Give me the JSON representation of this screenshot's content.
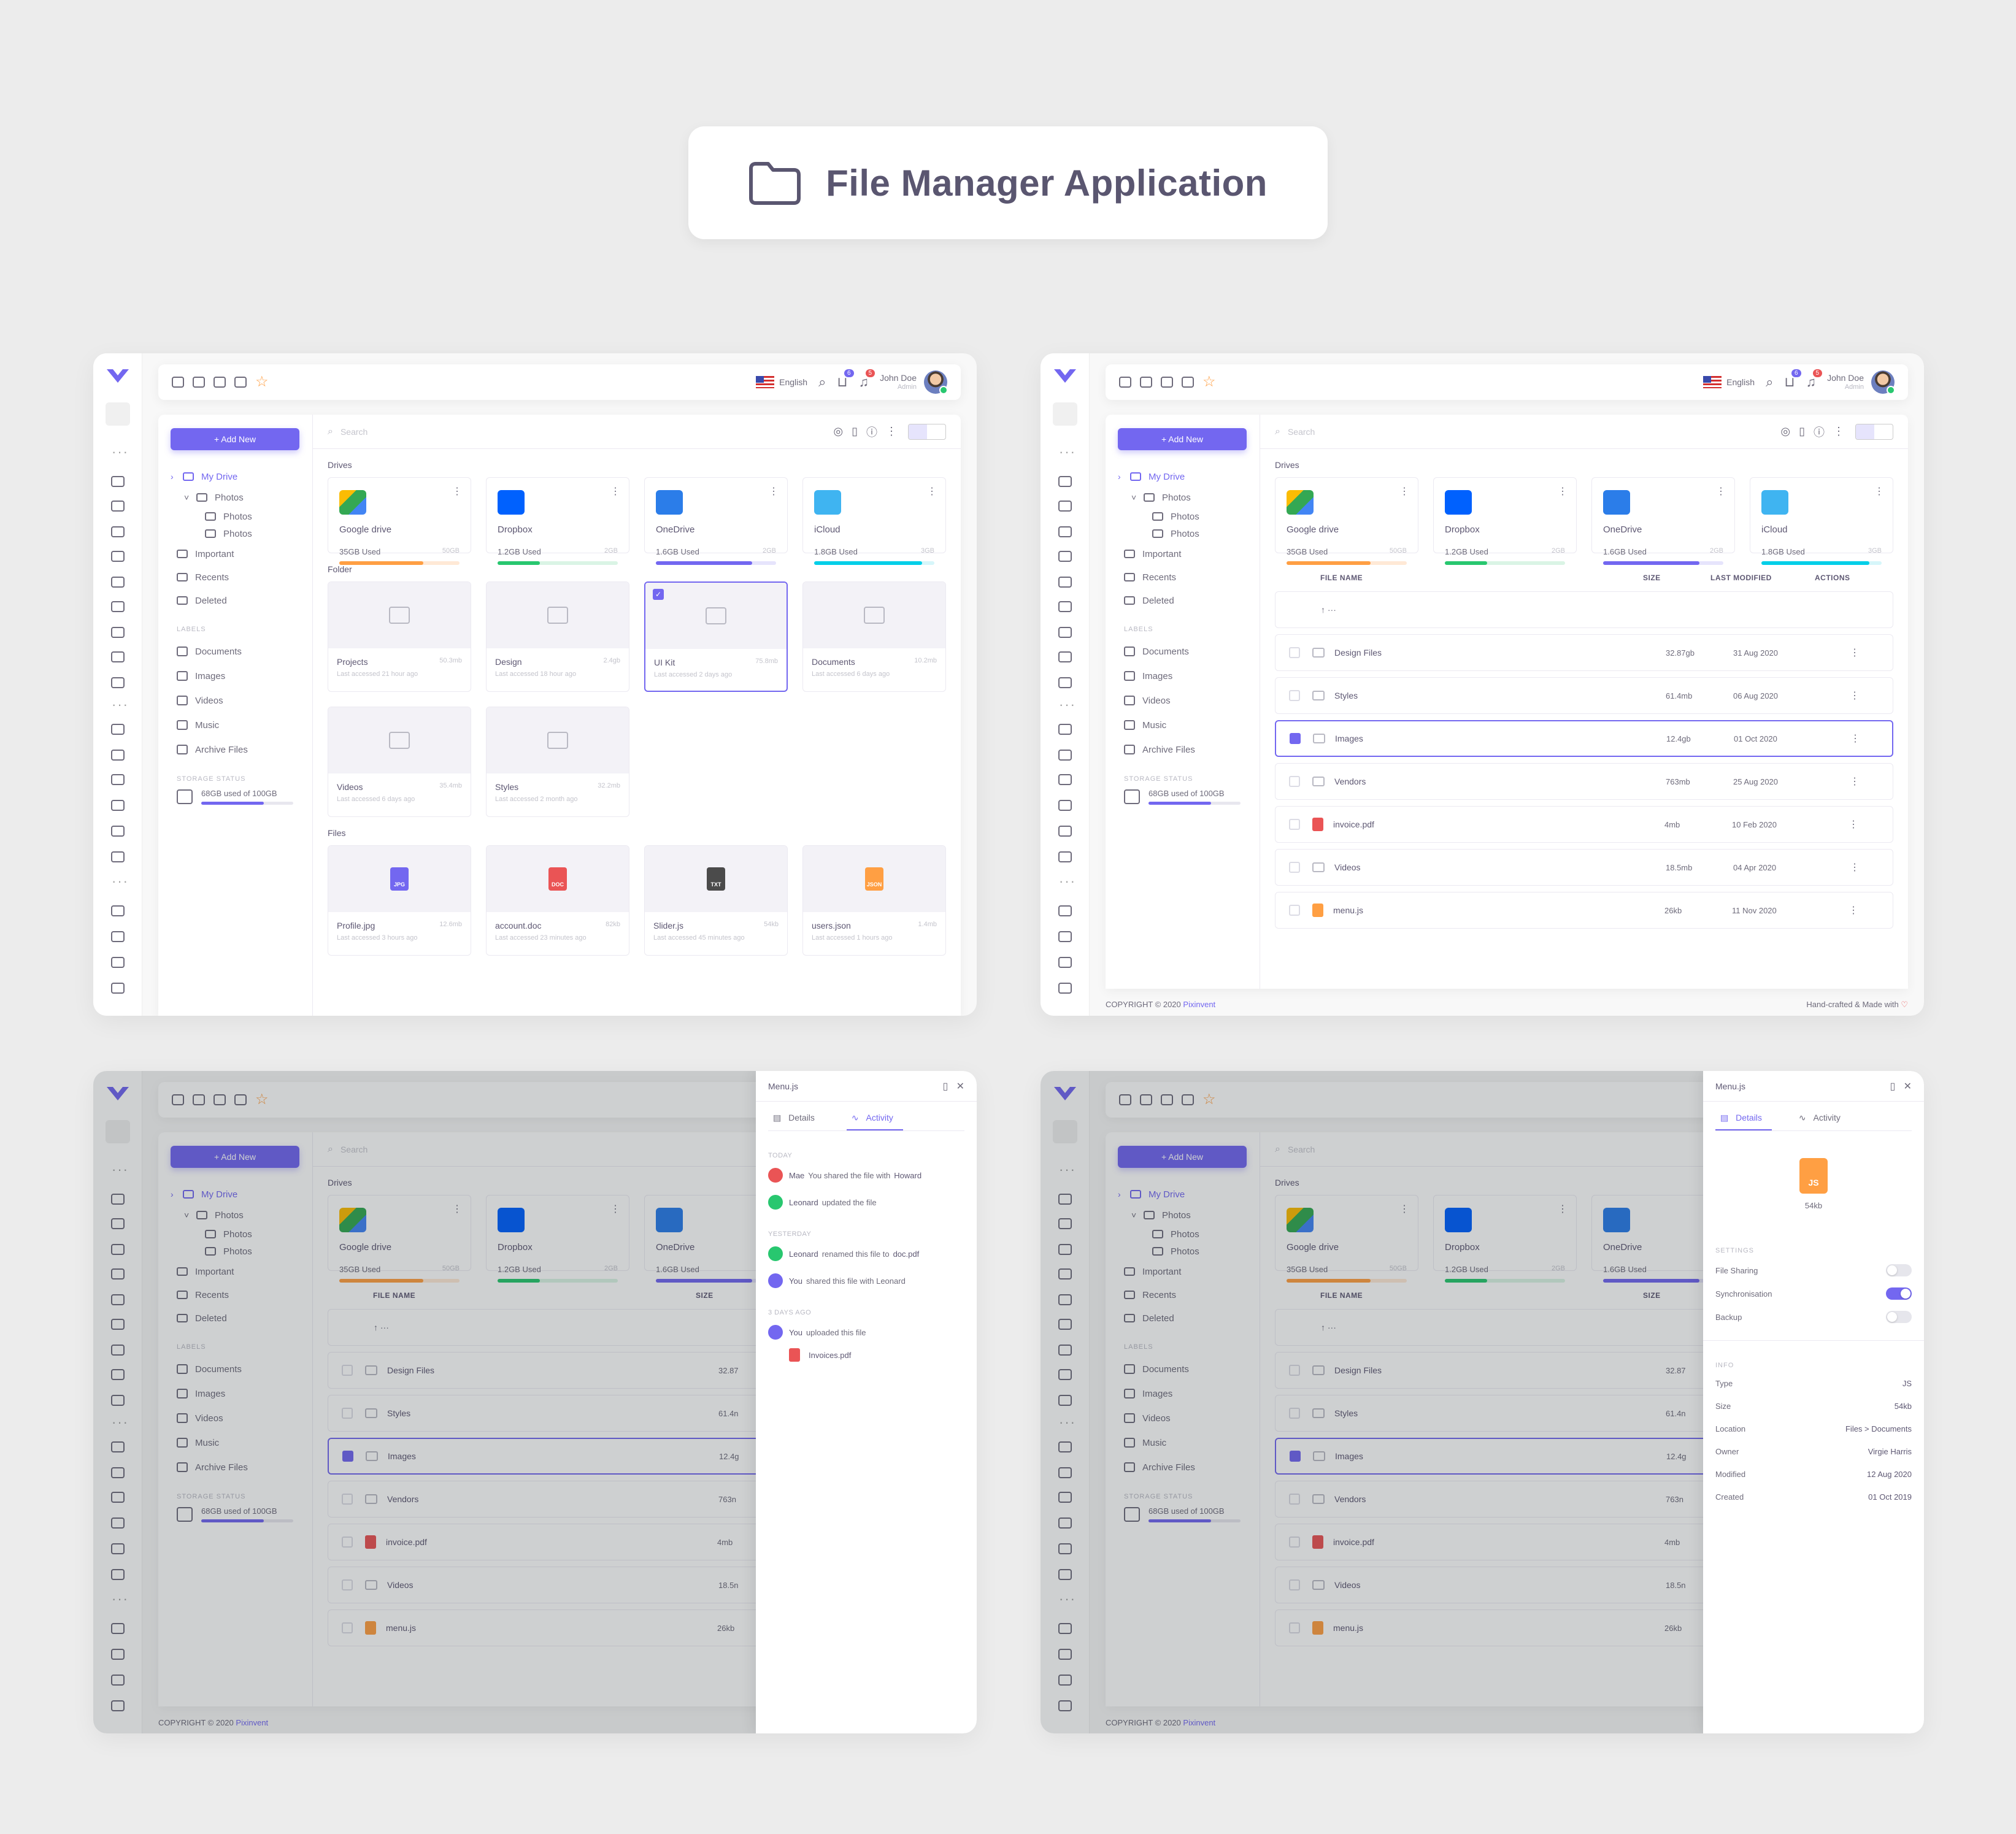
{
  "title": "File Manager Application",
  "colors": {
    "primary": "#7367f0",
    "warning": "#ff9f43",
    "success": "#28c76f",
    "danger": "#ea5455",
    "info": "#00cfe8"
  },
  "topbar": {
    "language": "English",
    "user_name": "John Doe",
    "user_role": "Admin",
    "cart_count": "6",
    "notif_count": "5"
  },
  "sidebar": {
    "add_new": "+ Add New",
    "my_drive": "My Drive",
    "photos": "Photos",
    "photos_sub1": "Photos",
    "photos_sub2": "Photos",
    "important": "Important",
    "recents": "Recents",
    "deleted": "Deleted",
    "labels_title": "LABELS",
    "labels": [
      "Documents",
      "Images",
      "Videos",
      "Music",
      "Archive Files"
    ],
    "storage_title": "STORAGE STATUS",
    "storage_text": "68GB used of 100GB",
    "storage_fraction": 0.68
  },
  "search_placeholder": "Search",
  "drives_label": "Drives",
  "drives": [
    {
      "name": "Google drive",
      "used": "35GB Used",
      "max": "50GB",
      "fraction": 0.7,
      "color": "#ff9f43",
      "track": "#ffe9d6"
    },
    {
      "name": "Dropbox",
      "used": "1.2GB Used",
      "max": "2GB",
      "fraction": 0.35,
      "color": "#28c76f",
      "track": "#daf4e5"
    },
    {
      "name": "OneDrive",
      "used": "1.6GB Used",
      "max": "2GB",
      "fraction": 0.8,
      "color": "#7367f0",
      "track": "#e6e4fc"
    },
    {
      "name": "iCloud",
      "used": "1.8GB Used",
      "max": "3GB",
      "fraction": 0.9,
      "color": "#00cfe8",
      "track": "#d6f6fa"
    }
  ],
  "folder_label": "Folder",
  "folders": [
    {
      "name": "Projects",
      "size": "50.3mb",
      "meta": "Last accessed 21 hour ago"
    },
    {
      "name": "Design",
      "size": "2.4gb",
      "meta": "Last accessed 18 hour ago"
    },
    {
      "name": "UI Kit",
      "size": "75.8mb",
      "meta": "Last accessed 2 days ago"
    },
    {
      "name": "Documents",
      "size": "10.2mb",
      "meta": "Last accessed 6 days ago"
    },
    {
      "name": "Videos",
      "size": "35.4mb",
      "meta": "Last accessed 6 days ago"
    },
    {
      "name": "Styles",
      "size": "32.2mb",
      "meta": "Last accessed 2 month ago"
    }
  ],
  "files_label": "Files",
  "files": [
    {
      "name": "Profile.jpg",
      "size": "12.6mb",
      "meta": "Last accessed 3 hours ago",
      "type": "JPG",
      "color": "#7367f0"
    },
    {
      "name": "account.doc",
      "size": "82kb",
      "meta": "Last accessed 23 minutes ago",
      "type": "DOC",
      "color": "#ea5455"
    },
    {
      "name": "Slider.js",
      "size": "54kb",
      "meta": "Last accessed 45 minutes ago",
      "type": "TXT",
      "color": "#4b4b4b"
    },
    {
      "name": "users.json",
      "size": "1.4mb",
      "meta": "Last accessed 1 hours ago",
      "type": "JSON",
      "color": "#ff9f43"
    }
  ],
  "table": {
    "headers": [
      "FILE NAME",
      "SIZE",
      "LAST MODIFIED",
      "ACTIONS"
    ],
    "up_row": "↑   ···",
    "rows": [
      {
        "name": "Design Files",
        "size": "32.87gb",
        "date": "31 Aug 2020",
        "icon": "folder"
      },
      {
        "name": "Styles",
        "size": "61.4mb",
        "date": "06 Aug 2020",
        "icon": "folder"
      },
      {
        "name": "Images",
        "size": "12.4gb",
        "date": "01 Oct 2020",
        "icon": "folder"
      },
      {
        "name": "Vendors",
        "size": "763mb",
        "date": "25 Aug 2020",
        "icon": "folder"
      },
      {
        "name": "invoice.pdf",
        "size": "4mb",
        "date": "10 Feb 2020",
        "icon": "pdf"
      },
      {
        "name": "Videos",
        "size": "18.5mb",
        "date": "04 Apr 2020",
        "icon": "folder"
      },
      {
        "name": "menu.js",
        "size": "26kb",
        "date": "11 Nov 2020",
        "icon": "js"
      }
    ],
    "cut_sizes": [
      "32.87",
      "61.4n",
      "12.4g",
      "763n",
      "4mb",
      "18.5n",
      "26kb"
    ]
  },
  "footer": {
    "copyright": "COPYRIGHT © 2020",
    "brand": "Pixinvent",
    "made": "Hand-crafted & Made with"
  },
  "drawer": {
    "title": "Menu.js",
    "tab_details": "Details",
    "tab_activity": "Activity",
    "activity": {
      "today": "TODAY",
      "a1_user": "Mae",
      "a1_text": "You shared the file with",
      "a1_target": "Howard",
      "a2_user": "Leonard",
      "a2_text": "updated the file",
      "yesterday": "YESTERDAY",
      "a3_user": "Leonard",
      "a3_text": "renamed this file to",
      "a3_target": "doc.pdf",
      "a4_user": "You",
      "a4_text": "shared this file with Leonard",
      "ago": "3 DAYS AGO",
      "a5_user": "You",
      "a5_text": "uploaded this file",
      "a5_file": "Invoices.pdf"
    },
    "details": {
      "badge": "JS",
      "size": "54kb",
      "settings_title": "SETTINGS",
      "toggles": [
        {
          "label": "File Sharing",
          "on": false
        },
        {
          "label": "Synchronisation",
          "on": true
        },
        {
          "label": "Backup",
          "on": false
        }
      ],
      "info_title": "INFO",
      "info": [
        {
          "k": "Type",
          "v": "JS"
        },
        {
          "k": "Size",
          "v": "54kb"
        },
        {
          "k": "Location",
          "v": "Files > Documents"
        },
        {
          "k": "Owner",
          "v": "Virgie Harris"
        },
        {
          "k": "Modified",
          "v": "12 Aug 2020"
        },
        {
          "k": "Created",
          "v": "01 Oct 2019"
        }
      ]
    }
  }
}
